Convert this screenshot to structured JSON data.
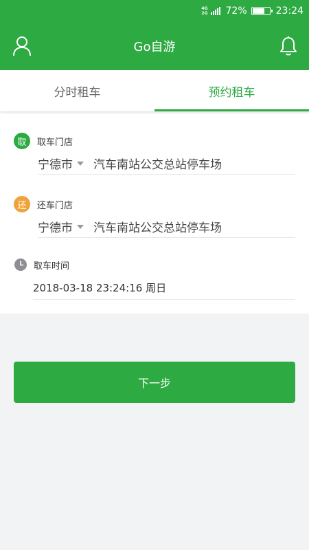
{
  "status_bar": {
    "network_top": "4G",
    "network_bottom": "2G",
    "battery_percent": "72%",
    "battery_level": 0.72,
    "time": "23:24"
  },
  "app_bar": {
    "title": "Go自游",
    "left_icon": "user-icon",
    "right_icon": "bell-icon"
  },
  "tabs": [
    {
      "label": "分时租车",
      "active": false
    },
    {
      "label": "预约租车",
      "active": true
    }
  ],
  "pickup": {
    "badge": "取",
    "label": "取车门店",
    "city": "宁德市",
    "store": "汽车南站公交总站停车场"
  },
  "return": {
    "badge": "还",
    "label": "还车门店",
    "city": "宁德市",
    "store": "汽车南站公交总站停车场"
  },
  "pickup_time": {
    "icon": "clock-icon",
    "label": "取车时间",
    "value": "2018-03-18 23:24:16 周日"
  },
  "next_button": {
    "label": "下一步"
  },
  "colors": {
    "primary": "#2eaa43",
    "return_badge": "#f0a33a",
    "background": "#f2f3f5"
  }
}
